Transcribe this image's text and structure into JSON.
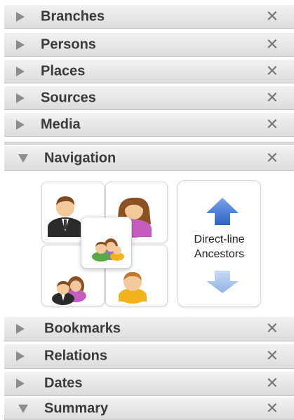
{
  "panels_top": [
    {
      "label": "Branches"
    },
    {
      "label": "Persons"
    },
    {
      "label": "Places"
    },
    {
      "label": "Sources"
    },
    {
      "label": "Media"
    }
  ],
  "navigation": {
    "label": "Navigation",
    "direct_line_line1": "Direct-line",
    "direct_line_line2": "Ancestors"
  },
  "panels_bottom": [
    {
      "label": "Bookmarks"
    },
    {
      "label": "Relations"
    },
    {
      "label": "Dates"
    },
    {
      "label": "Summary"
    }
  ],
  "close_glyph": "✕"
}
